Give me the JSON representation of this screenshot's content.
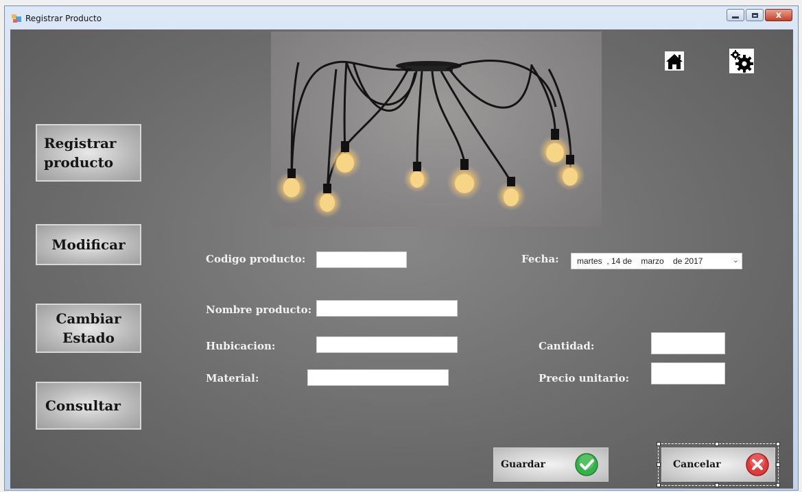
{
  "window": {
    "title": "Registrar Producto",
    "controls": {
      "minimize": "–",
      "maximize": "□",
      "close": "x"
    }
  },
  "sidebar": {
    "items": [
      {
        "label_line1": "Registrar",
        "label_line2": "producto"
      },
      {
        "label_line1": "Modificar"
      },
      {
        "label_line1": "Cambiar",
        "label_line2": "Estado"
      },
      {
        "label_line1": "Consultar"
      }
    ]
  },
  "header": {
    "icons": [
      "home-icon",
      "gear-icon"
    ],
    "image": "pendant-lamp-photo"
  },
  "form": {
    "codigo_label": "Codigo producto:",
    "codigo_value": "",
    "fecha_label": "Fecha:",
    "fecha_value": "martes  , 14 de    marzo    de 2017",
    "nombre_label": "Nombre producto:",
    "nombre_value": "",
    "hubicacion_label": "Hubicacion:",
    "hubicacion_value": "",
    "material_label": "Material:",
    "material_value": "",
    "cantidad_label": "Cantidad:",
    "cantidad_value": "",
    "precio_label": "Precio unitario:",
    "precio_value": ""
  },
  "actions": {
    "guardar_label": "Guardar",
    "cancelar_label": "Cancelar"
  },
  "colors": {
    "client_bg": "#6f6f6f",
    "label_text": "#f2f2f2",
    "ok_green": "#36b24a",
    "cancel_red": "#e03a3a"
  }
}
